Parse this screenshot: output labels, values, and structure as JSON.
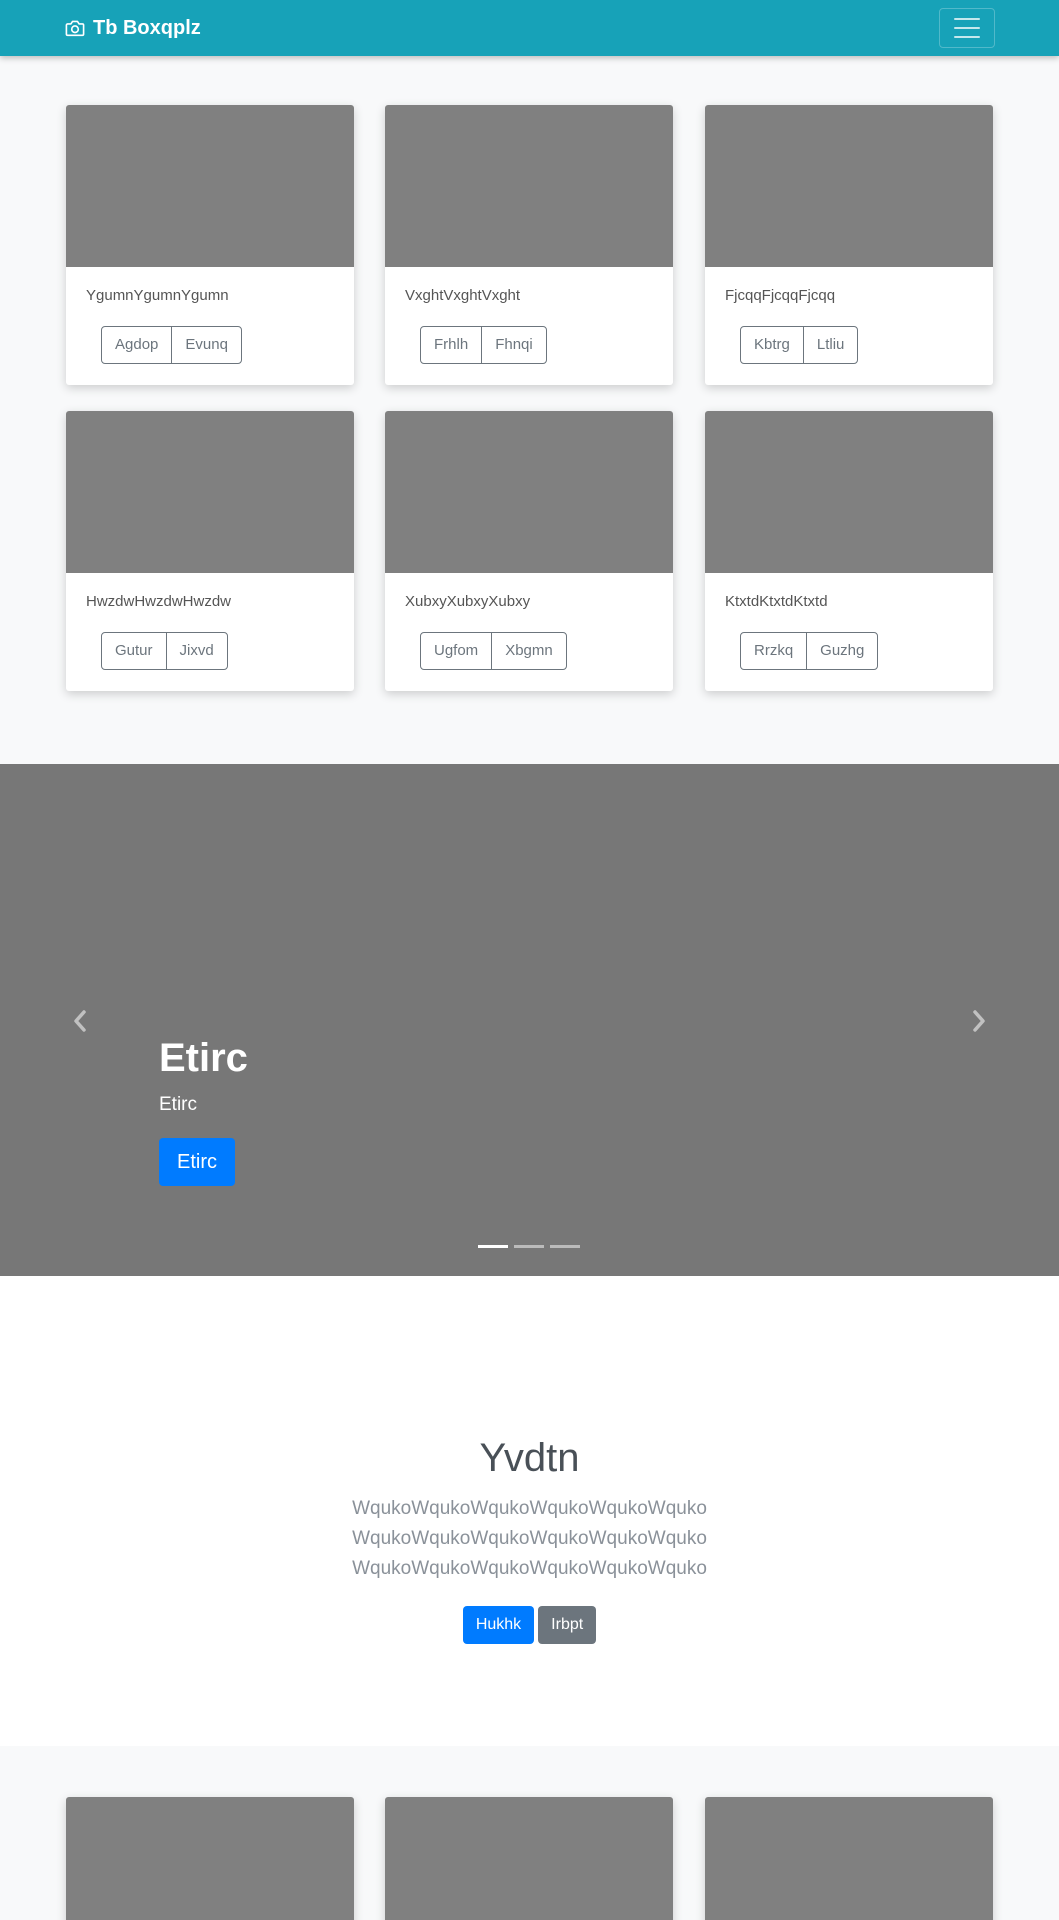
{
  "navbar": {
    "brand": "Tb Boxqplz",
    "brand_icon": "camera-icon",
    "toggler_icon": "hamburger-icon"
  },
  "album": {
    "cards": [
      {
        "text": "YgumnYgumnYgumn",
        "buttons": [
          "Agdop",
          "Evunq"
        ]
      },
      {
        "text": "VxghtVxghtVxght",
        "buttons": [
          "Frhlh",
          "Fhnqi"
        ]
      },
      {
        "text": "FjcqqFjcqqFjcqq",
        "buttons": [
          "Kbtrg",
          "Ltliu"
        ]
      },
      {
        "text": "HwzdwHwzdwHwzdw",
        "buttons": [
          "Gutur",
          "Jixvd"
        ]
      },
      {
        "text": "XubxyXubxyXubxy",
        "buttons": [
          "Ugfom",
          "Xbgmn"
        ]
      },
      {
        "text": "KtxtdKtxtdKtxtd",
        "buttons": [
          "Rrzkq",
          "Guzhg"
        ]
      }
    ]
  },
  "carousel": {
    "title": "Etirc",
    "text": "Etirc",
    "button": "Etirc",
    "prev_icon": "chevron-left-icon",
    "next_icon": "chevron-right-icon",
    "slide_count": 3,
    "active_slide": 1
  },
  "jumbotron": {
    "title": "Yvdtn",
    "lead_lines": [
      "WqukoWqukoWqukoWqukoWqukoWquko",
      "WqukoWqukoWqukoWqukoWqukoWquko",
      "WqukoWqukoWqukoWqukoWqukoWquko"
    ],
    "primary_button": "Hukhk",
    "secondary_button": "Irbpt"
  },
  "colors": {
    "navbar": "#17a2b8",
    "primary": "#007bff",
    "secondary": "#6c757d",
    "placeholder": "#808080",
    "carousel_bg": "#777777",
    "section_bg": "#f8f9fa"
  }
}
